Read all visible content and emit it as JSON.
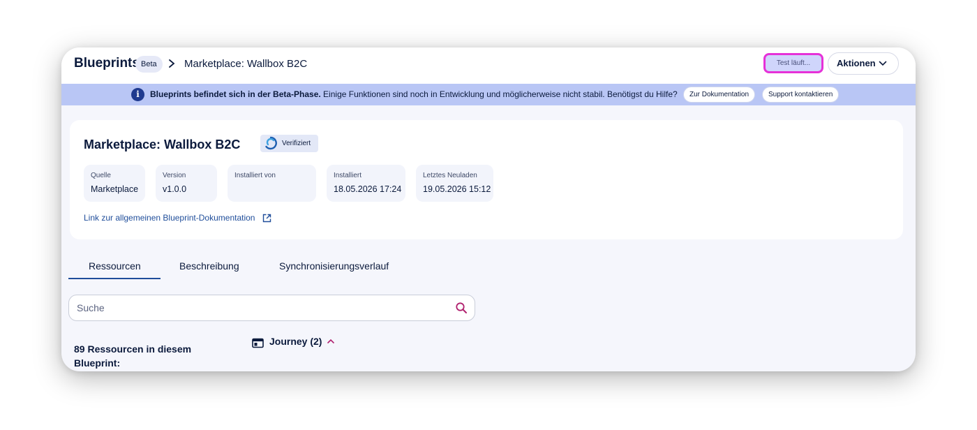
{
  "header": {
    "app_title": "Blueprints",
    "beta_badge": "Beta",
    "breadcrumb": "Marketplace: Wallbox B2C",
    "test_button": "Test läuft...",
    "actions_button": "Aktionen"
  },
  "banner": {
    "bold_text": "Blueprints befindet sich in der Beta-Phase.",
    "text": " Einige Funktionen sind noch in Entwicklung und möglicherweise nicht stabil. Benötigst du Hilfe?",
    "docs_button": "Zur Dokumentation",
    "support_button": "Support kontaktieren"
  },
  "card": {
    "title": "Marketplace: Wallbox B2C",
    "verified_label": "Verifiziert",
    "meta": [
      {
        "label": "Quelle",
        "value": "Marketplace"
      },
      {
        "label": "Version",
        "value": "v1.0.0"
      },
      {
        "label": "Installiert von",
        "value": ""
      },
      {
        "label": "Installiert",
        "value": "18.05.2026 17:24"
      },
      {
        "label": "Letztes Neuladen",
        "value": "19.05.2026 15:12"
      }
    ],
    "doc_link": "Link zur allgemeinen Blueprint-Dokumentation"
  },
  "tabs": [
    {
      "label": "Ressourcen",
      "active": true
    },
    {
      "label": "Beschreibung",
      "active": false
    },
    {
      "label": "Synchronisierungsverlauf",
      "active": false
    }
  ],
  "search": {
    "placeholder": "Suche",
    "value": ""
  },
  "resources": {
    "count_text": "89 Ressourcen in diesem Blueprint:",
    "group_label": "Journey (2)"
  },
  "colors": {
    "primary_text": "#0b1a3c",
    "banner_bg": "#b9c6f5",
    "highlight_border": "#e631d8",
    "link": "#1f4d9a",
    "accent_magenta": "#b0206e"
  }
}
